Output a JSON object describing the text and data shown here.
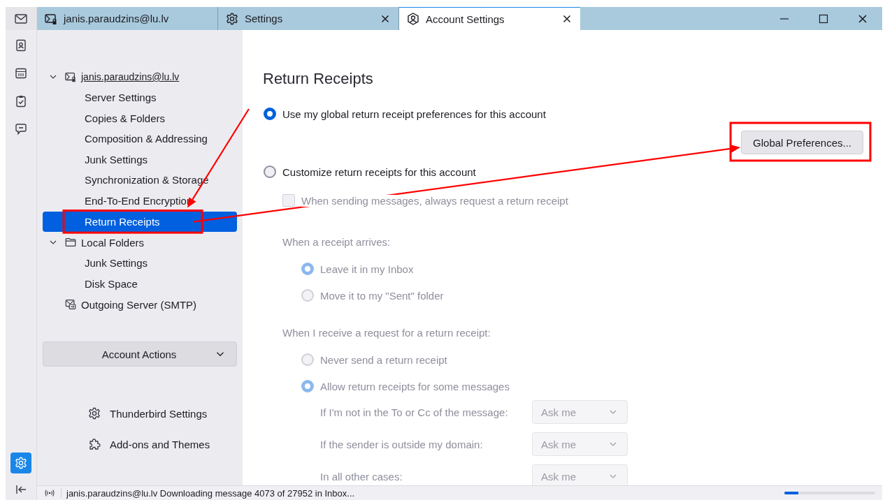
{
  "rail": {
    "items": [
      {
        "kind": "mail",
        "selected": false
      },
      {
        "kind": "addressbook",
        "selected": false
      },
      {
        "kind": "calendar",
        "selected": false
      },
      {
        "kind": "tasks",
        "selected": false
      },
      {
        "kind": "chat",
        "selected": false
      },
      {
        "kind": "settings",
        "selected": true
      },
      {
        "kind": "collapse",
        "selected": false
      }
    ]
  },
  "tabs": [
    {
      "label": "janis.paraudzins@lu.lv",
      "kind": "mail",
      "closable": false,
      "selected": false
    },
    {
      "label": "Settings",
      "kind": "gear",
      "closable": true,
      "selected": false
    },
    {
      "label": "Account Settings",
      "kind": "account",
      "closable": true,
      "selected": true
    }
  ],
  "sidebar": {
    "accounts": [
      {
        "label": "janis.paraudzins@lu.lv",
        "kind": "mail",
        "expanded": true,
        "children": [
          {
            "label": "Server Settings",
            "selected": false
          },
          {
            "label": "Copies & Folders",
            "selected": false
          },
          {
            "label": "Composition & Addressing",
            "selected": false
          },
          {
            "label": "Junk Settings",
            "selected": false
          },
          {
            "label": "Synchronization & Storage",
            "selected": false
          },
          {
            "label": "End-To-End Encryption",
            "selected": false
          },
          {
            "label": "Return Receipts",
            "selected": true
          }
        ]
      },
      {
        "label": "Local Folders",
        "kind": "folder",
        "expanded": true,
        "children": [
          {
            "label": "Junk Settings",
            "selected": false
          },
          {
            "label": "Disk Space",
            "selected": false
          }
        ]
      },
      {
        "label": "Outgoing Server (SMTP)",
        "kind": "smtp"
      }
    ],
    "account_actions": "Account Actions",
    "links": [
      {
        "label": "Thunderbird Settings",
        "kind": "gear"
      },
      {
        "label": "Add-ons and Themes",
        "kind": "puzzle"
      }
    ]
  },
  "content": {
    "title": "Return Receipts",
    "options": [
      {
        "label": "Use my global return receipt preferences for this account",
        "selected": true
      },
      {
        "label": "Customize return receipts for this account",
        "selected": false
      }
    ],
    "global_button": "Global Preferences...",
    "custom": {
      "disabled": true,
      "request_checkbox": {
        "label": "When sending messages, always request a return receipt",
        "checked": false
      },
      "arrives": {
        "heading": "When a receipt arrives:",
        "options": [
          {
            "label": "Leave it in my Inbox",
            "selected": true
          },
          {
            "label": "Move it to my \"Sent\" folder",
            "selected": false
          }
        ]
      },
      "request": {
        "heading": "When I receive a request for a return receipt:",
        "options": [
          {
            "label": "Never send a return receipt",
            "selected": false
          },
          {
            "label": "Allow return receipts for some messages",
            "selected": true
          }
        ]
      },
      "rules": [
        {
          "label": "If I'm not in the To or Cc of the message:",
          "value": "Ask me"
        },
        {
          "label": "If the sender is outside my domain:",
          "value": "Ask me"
        },
        {
          "label": "In all other cases:",
          "value": "Ask me"
        }
      ]
    }
  },
  "status_bar": {
    "text": "janis.paraudzins@lu.lv Downloading message 4073 of 27952 in Inbox...",
    "progress": {
      "level": 0.15
    }
  },
  "annotations": [
    {
      "kind": "box"
    },
    {
      "kind": "box"
    },
    {
      "kind": "arrow"
    },
    {
      "kind": "arrow"
    }
  ]
}
